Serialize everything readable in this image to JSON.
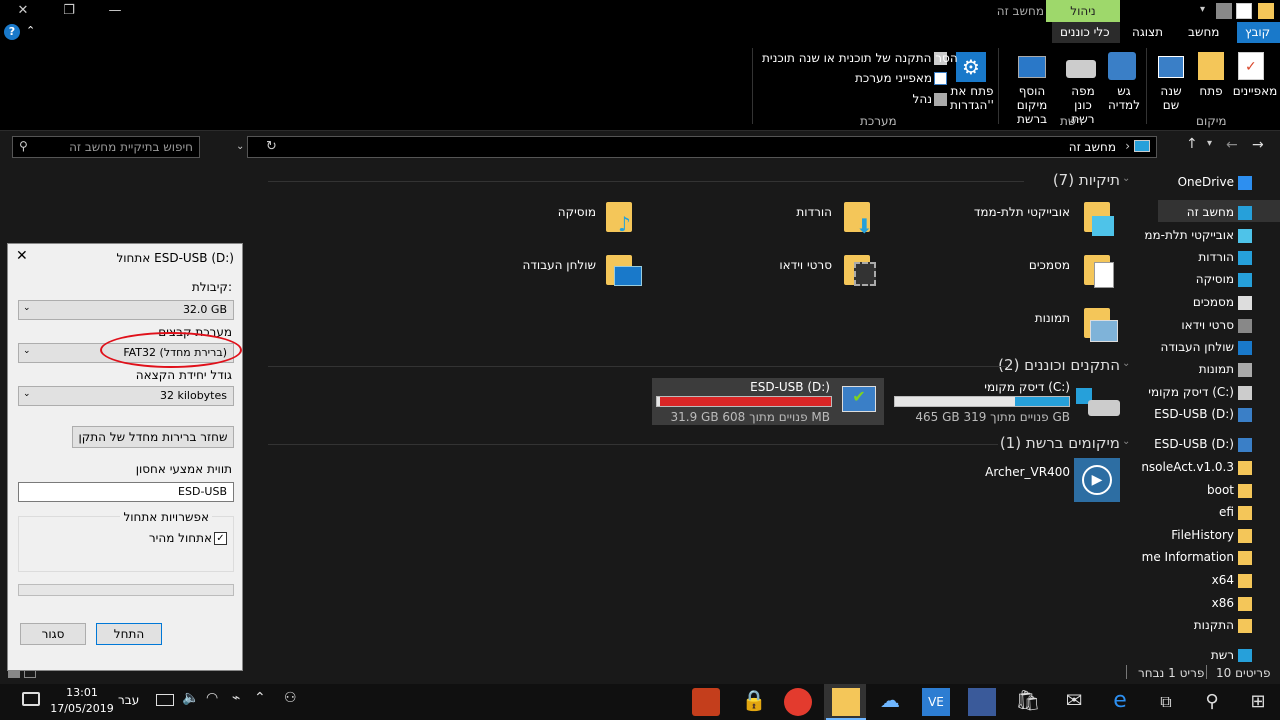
{
  "window": {
    "title": "מחשב זה",
    "context_tab": "ניהול"
  },
  "ribbon_tabs": {
    "file": "קובץ",
    "computer": "מחשב",
    "view": "תצוגה",
    "drive_tools": "כלי כוננים"
  },
  "ribbon": {
    "location": {
      "label": "מיקום",
      "properties": "מאפיינים",
      "open": "פתח",
      "rename": "שנה שם"
    },
    "network": {
      "label": "רשת",
      "access_media": "גש למדיה",
      "map_drive": "מפה כונן רשת",
      "add_location": "הוסף מיקום ברשת"
    },
    "system": {
      "label": "מערכת",
      "open_settings": "פתח את 'הגדרות'",
      "uninstall": "הסר התקנה של תוכנית או שנה תוכנית",
      "system_props": "מאפייני מערכת",
      "manage": "נהל"
    }
  },
  "address": {
    "path": "מחשב זה",
    "search_placeholder": "חיפוש בתיקיית מחשב זה"
  },
  "sections": {
    "folders": "תיקיות (7)",
    "devices": "התקנים וכוננים (2)",
    "network": "מיקומים ברשת (1)"
  },
  "folders": [
    {
      "name": "אובייקטי תלת-ממד"
    },
    {
      "name": "הורדות"
    },
    {
      "name": "מוסיקה"
    },
    {
      "name": "מסמכים"
    },
    {
      "name": "סרטי וידאו"
    },
    {
      "name": "שולחן העבודה"
    },
    {
      "name": "תמונות"
    }
  ],
  "drives": [
    {
      "name": "דיסק מקומי (C:)",
      "free_text": "465 GB פנויים מתוך 319 GB",
      "usage": 0.31,
      "color": "#26a0da"
    },
    {
      "name": "ESD-USB (D:)",
      "free_text": "31.9 GB פנויים מתוך 608 MB",
      "usage": 0.98,
      "color": "#da2626"
    }
  ],
  "network_items": [
    {
      "name": "Archer_VR400"
    }
  ],
  "nav": [
    "OneDrive",
    "מחשב זה",
    "אובייקטי תלת-ממ",
    "הורדות",
    "מוסיקה",
    "מסמכים",
    "סרטי וידאו",
    "שולחן העבודה",
    "תמונות",
    "דיסק מקומי (C:)",
    "ESD-USB (D:)",
    "ESD-USB (D:)",
    "nsoleAct.v1.0.3",
    "boot",
    "efi",
    "FileHistory",
    "me Information",
    "x64",
    "x86",
    "התקנות",
    "רשת"
  ],
  "status": {
    "items": "10 פריטים",
    "selected": "פריט 1 נבחר"
  },
  "taskbar": {
    "time": "13:01",
    "date": "17/05/2019",
    "lang": "עבר"
  },
  "dialog": {
    "title": "אתחול ESD-USB (D:)",
    "capacity_label": "קיבולת:",
    "capacity_value": "32.0 GB",
    "fs_label": "מערכת קבצים",
    "fs_value": "FAT32 (ברירת מחדל)",
    "alloc_label": "גודל יחידת הקצאה",
    "alloc_value": "32 kilobytes",
    "restore_btn": "שחזר ברירות מחדל של התקן",
    "volume_label": "תווית אמצעי אחסון",
    "volume_value": "ESD-USB",
    "options_label": "אפשרויות אתחול",
    "quick_format": "אתחול מהיר",
    "start_btn": "התחל",
    "close_btn": "סגור"
  }
}
